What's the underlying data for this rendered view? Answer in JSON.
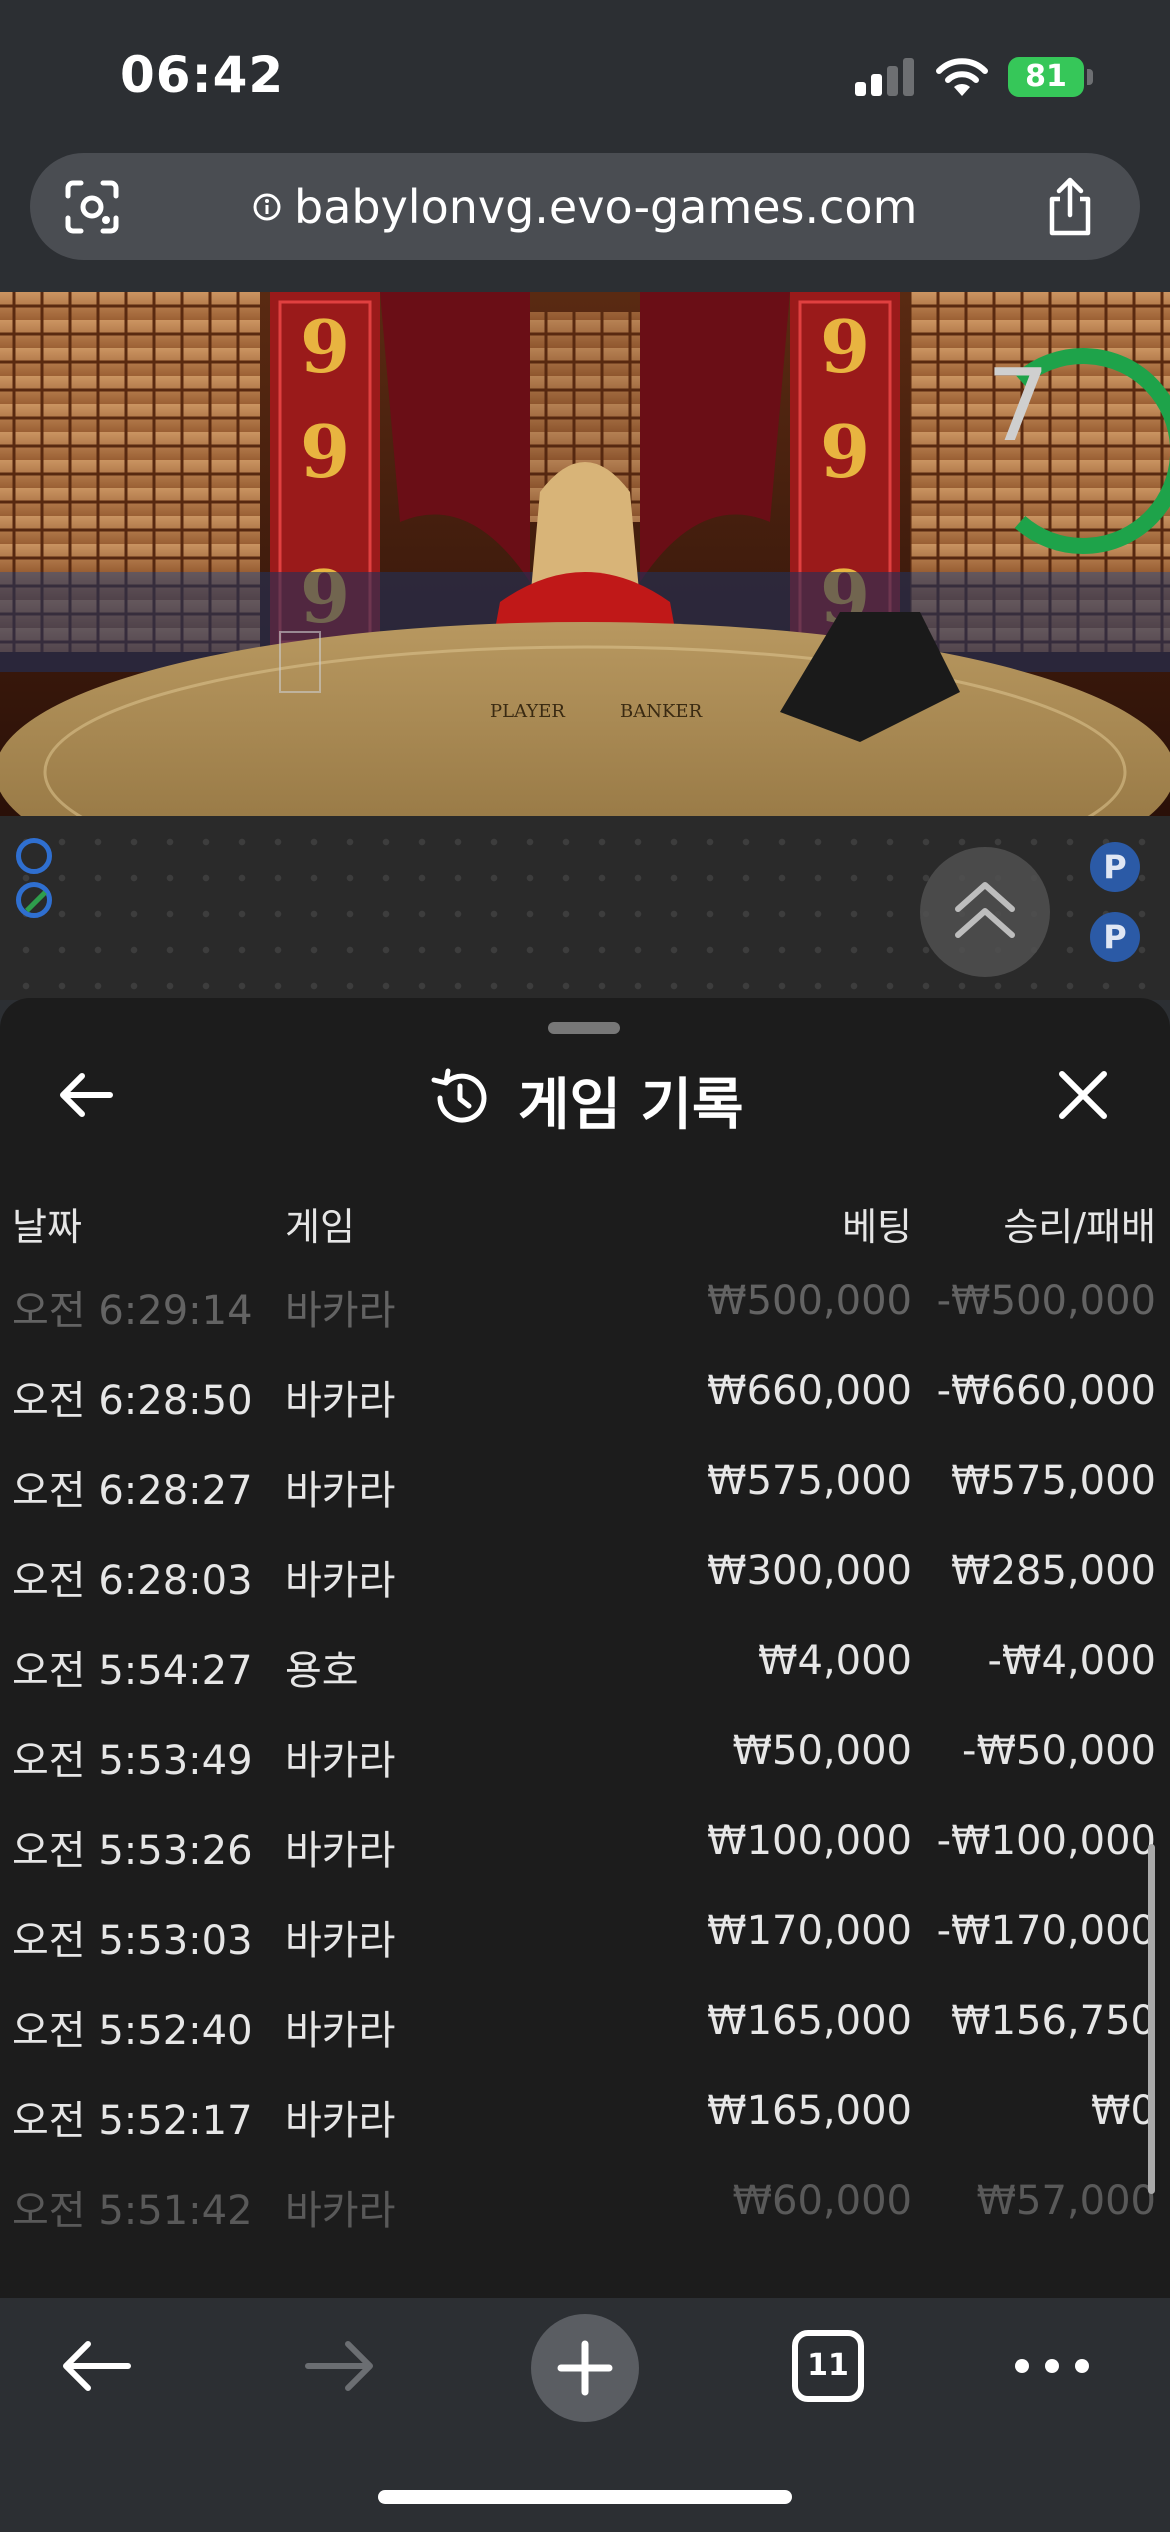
{
  "status_bar": {
    "time": "06:42",
    "battery": "81"
  },
  "browser": {
    "url": "babylonvg.evo-games.com",
    "open_tabs": "11"
  },
  "video": {
    "countdown": "7",
    "table_labels": {
      "player": "PLAYER",
      "banker": "BANKER"
    },
    "pillar_digits": [
      "9",
      "9",
      "9"
    ]
  },
  "road": {
    "badges": [
      "P",
      "P"
    ]
  },
  "sheet": {
    "title": "게임 기록",
    "columns": {
      "date": "날짜",
      "game": "게임",
      "bet": "베팅",
      "result": "승리/패배"
    },
    "rows": [
      {
        "date": "오전 6:29:14",
        "game": "바카라",
        "bet": "₩500,000",
        "result": "-₩500,000"
      },
      {
        "date": "오전 6:28:50",
        "game": "바카라",
        "bet": "₩660,000",
        "result": "-₩660,000"
      },
      {
        "date": "오전 6:28:27",
        "game": "바카라",
        "bet": "₩575,000",
        "result": "₩575,000"
      },
      {
        "date": "오전 6:28:03",
        "game": "바카라",
        "bet": "₩300,000",
        "result": "₩285,000"
      },
      {
        "date": "오전 5:54:27",
        "game": "용호",
        "bet": "₩4,000",
        "result": "-₩4,000"
      },
      {
        "date": "오전 5:53:49",
        "game": "바카라",
        "bet": "₩50,000",
        "result": "-₩50,000"
      },
      {
        "date": "오전 5:53:26",
        "game": "바카라",
        "bet": "₩100,000",
        "result": "-₩100,000"
      },
      {
        "date": "오전 5:53:03",
        "game": "바카라",
        "bet": "₩170,000",
        "result": "-₩170,000"
      },
      {
        "date": "오전 5:52:40",
        "game": "바카라",
        "bet": "₩165,000",
        "result": "₩156,750"
      },
      {
        "date": "오전 5:52:17",
        "game": "바카라",
        "bet": "₩165,000",
        "result": "₩0"
      },
      {
        "date": "오전 5:51:42",
        "game": "바카라",
        "bet": "₩60,000",
        "result": "₩57,000"
      }
    ]
  }
}
